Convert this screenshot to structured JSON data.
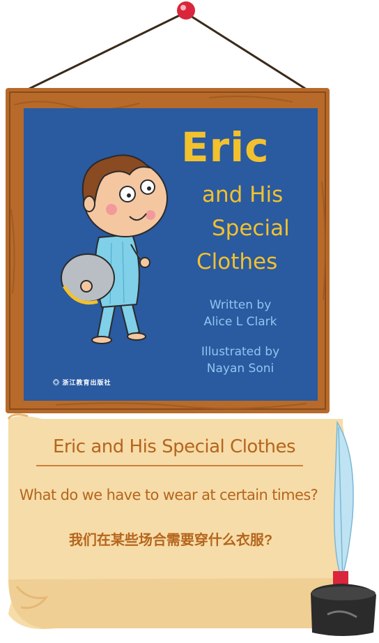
{
  "cover": {
    "title": "Eric",
    "subtitle_lines": [
      "and His",
      "Special",
      "Clothes"
    ],
    "written_by_label": "Written by",
    "author": "Alice L Clark",
    "illustrated_by_label": "Illustrated by",
    "illustrator": "Nayan Soni",
    "publisher": "浙江教育出版社"
  },
  "scroll": {
    "book_title": "Eric and His Special Clothes",
    "question_en": "What do we have to wear at certain times?",
    "question_zh": "我们在某些场合需要穿什么衣服?"
  },
  "colors": {
    "cover_blue": "#2a5aa0",
    "title_yellow": "#f2c12e",
    "credit_blue": "#8ec7f0",
    "frame_brown": "#b76a2a",
    "parchment": "#f6dca8",
    "text_brown": "#b5651d",
    "pin_red": "#d9263b"
  },
  "icons": [
    "pushpin-icon",
    "quill-pen-icon",
    "inkwell-icon",
    "boy-illustration"
  ]
}
